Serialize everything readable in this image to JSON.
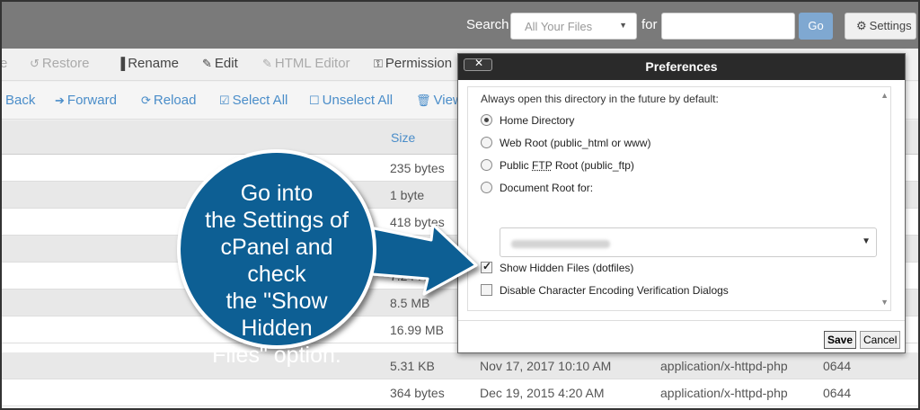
{
  "topbar": {
    "search_label": "Search",
    "search_scope": "All Your Files",
    "for_label": "for",
    "search_value": "",
    "go_label": "Go",
    "settings_label": "Settings"
  },
  "toolbar1": {
    "partial_prev": "e",
    "restore": "Restore",
    "rename": "Rename",
    "edit": "Edit",
    "html_editor": "HTML Editor",
    "permissions": "Permission"
  },
  "toolbar2": {
    "back": "Back",
    "forward": "Forward",
    "reload": "Reload",
    "select_all": "Select All",
    "unselect_all": "Unselect All",
    "view": "View"
  },
  "listing": {
    "size_header": "Size",
    "rows": [
      {
        "size": "235 bytes",
        "modified": "",
        "type": "",
        "perms": ""
      },
      {
        "size": "1 byte",
        "modified": "",
        "type": "",
        "perms": ""
      },
      {
        "size": "418 bytes",
        "modified": "",
        "type": "",
        "perms": ""
      },
      {
        "size": "",
        "modified": "",
        "type": "",
        "perms": ""
      },
      {
        "size": "7.24 KB",
        "modified": "",
        "type": "",
        "perms": ""
      },
      {
        "size": "8.5 MB",
        "modified": "",
        "type": "",
        "perms": ""
      },
      {
        "size": "16.99 MB",
        "modified": "",
        "type": "",
        "perms": ""
      },
      {
        "size": "5.31 KB",
        "modified": "Nov 17, 2017 10:10 AM",
        "type": "application/x-httpd-php",
        "perms": "0644"
      },
      {
        "size": "364 bytes",
        "modified": "Dec 19, 2015 4:20 AM",
        "type": "application/x-httpd-php",
        "perms": "0644"
      }
    ]
  },
  "dialog": {
    "title": "Preferences",
    "close_glyph": "✕",
    "default_dir_label": "Always open this directory in the future by default:",
    "options": {
      "home": "Home Directory",
      "webroot": "Web Root (public_html or www)",
      "ftp_prefix": "Public ",
      "ftp_abbr": "FTP",
      "ftp_suffix": " Root (public_ftp)",
      "docroot": "Document Root for:"
    },
    "selected": "home",
    "show_hidden": "Show Hidden Files (dotfiles)",
    "show_hidden_checked": true,
    "disable_encoding": "Disable Character Encoding Verification Dialogs",
    "disable_encoding_checked": false,
    "save": "Save",
    "cancel": "Cancel"
  },
  "callout": {
    "text": "Go into the Settings of cPanel and check the \"Show Hidden Files\" option.",
    "line1": "Go into",
    "line2": "the Settings of",
    "line3": "cPanel and check",
    "line4": "the \"Show Hidden",
    "line5": "Files\" option.",
    "bubble_color": "#0e5f94",
    "arrow_color": "#0e5f94"
  },
  "colors": {
    "topbar": "#7a7a7a",
    "link_blue": "#4a8dc9",
    "go_button": "#7fa8d1",
    "dialog_title": "#2a2a2a"
  }
}
